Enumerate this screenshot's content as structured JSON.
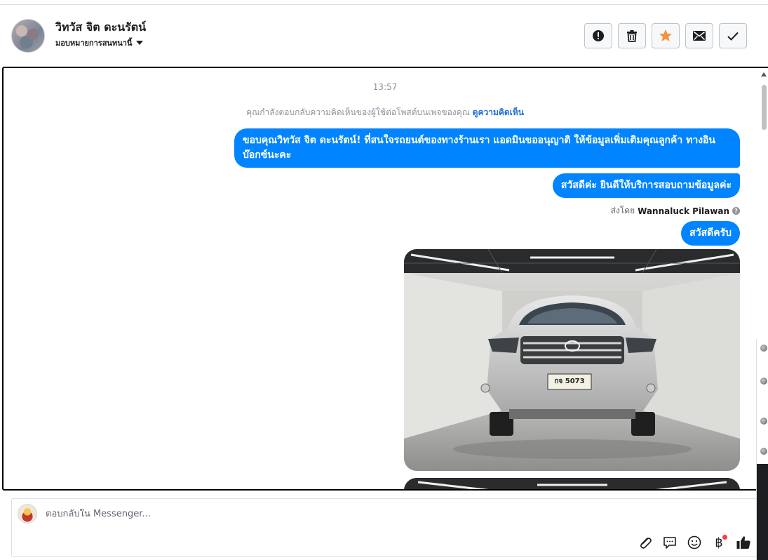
{
  "header": {
    "contact_name": "วิทวัส จิต ดะนรัตน์",
    "assign_label": "มอบหมายการสนทนานี้",
    "actions": [
      {
        "name": "spam-icon",
        "label": "Mark as spam"
      },
      {
        "name": "trash-icon",
        "label": "Delete"
      },
      {
        "name": "star-icon",
        "label": "Star",
        "color": "#f5923e"
      },
      {
        "name": "envelope-icon",
        "label": "Mark as unread"
      },
      {
        "name": "checkmark-icon",
        "label": "Mark as done"
      }
    ]
  },
  "thread": {
    "timestamp": "13:57",
    "notice_text": "คุณกำลังตอบกลับความคิดเห็นของผู้ใช้ต่อโพสต์บนเพจของคุณ",
    "notice_link": "ดูความคิดเห็น",
    "messages": [
      "ขอบคุณวิทวัส จิต ดะนรัตน์! ที่สนใจรถยนต์ของทางร้านเรา แอดมินขออนุญาติ ให้ข้อมูลเพิ่มเติมคุณลูกค้า ทางอินบ๊อกซ์นะคะ",
      "สวัสดีค่ะ  ยินดีให้บริการสอบถามข้อมูลค่ะ",
      "สวัสดีครับ"
    ],
    "sent_by_label": "ส่งโดย",
    "sent_by_name": "Wannaluck Pilawan",
    "plate_text": "กจ 5073",
    "bubble_color": "#0084ff"
  },
  "composer": {
    "placeholder": "ตอบกลับใน Messenger...",
    "tools": [
      "paperclip-icon",
      "speech-bubble-icon",
      "smiley-icon",
      "baht-icon",
      "thumbs-up-icon"
    ],
    "baht_symbol": "฿"
  }
}
